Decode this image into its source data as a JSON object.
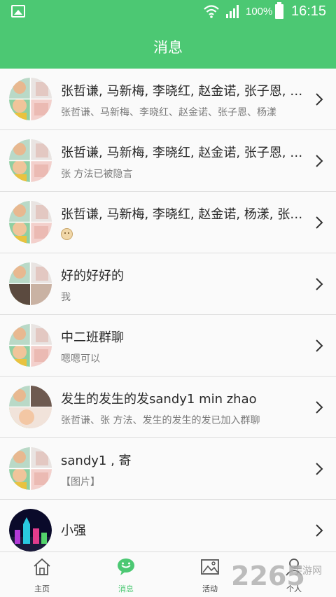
{
  "status_bar": {
    "left_icon": "gallery-icon",
    "battery_percent": "100%",
    "time": "16:15"
  },
  "header": {
    "title": "消息"
  },
  "conversations": [
    {
      "name": "张哲谦, 马新梅, 李晓红, 赵金诺, 张子恩, 杨漾,",
      "preview": "张哲谦、马新梅、李晓红、赵金诺、张子恩、杨漾"
    },
    {
      "name": "张哲谦, 马新梅, 李晓红, 赵金诺, 张子恩, 杨漾,",
      "preview": "张 方法已被隐言"
    },
    {
      "name": "张哲谦, 马新梅, 李晓红, 赵金诺, 杨漾, 张子恩",
      "preview": "",
      "preview_icon": "smiley-emoji-icon"
    },
    {
      "name": "好的好好的",
      "preview": "我"
    },
    {
      "name": "中二班群聊",
      "preview": "嗯嗯可以"
    },
    {
      "name": "发生的发生的发sandy1 min zhao",
      "preview": "张哲谦、张 方法、发生的发生的发已加入群聊"
    },
    {
      "name": "sandy1 , 寄",
      "preview": "【图片】"
    },
    {
      "name": "小强",
      "preview": ""
    }
  ],
  "tabs": [
    {
      "label": "主页",
      "icon": "home-icon",
      "active": false
    },
    {
      "label": "消息",
      "icon": "chat-bubble-icon",
      "active": true
    },
    {
      "label": "活动",
      "icon": "picture-icon",
      "active": false
    },
    {
      "label": "个人",
      "icon": "person-icon",
      "active": false
    }
  ],
  "watermark": {
    "text": "2265",
    "site": "手游网"
  },
  "colors": {
    "brand_green": "#4cc873",
    "text_dark": "#2a2a2a",
    "text_grey": "#7a7a7a"
  }
}
